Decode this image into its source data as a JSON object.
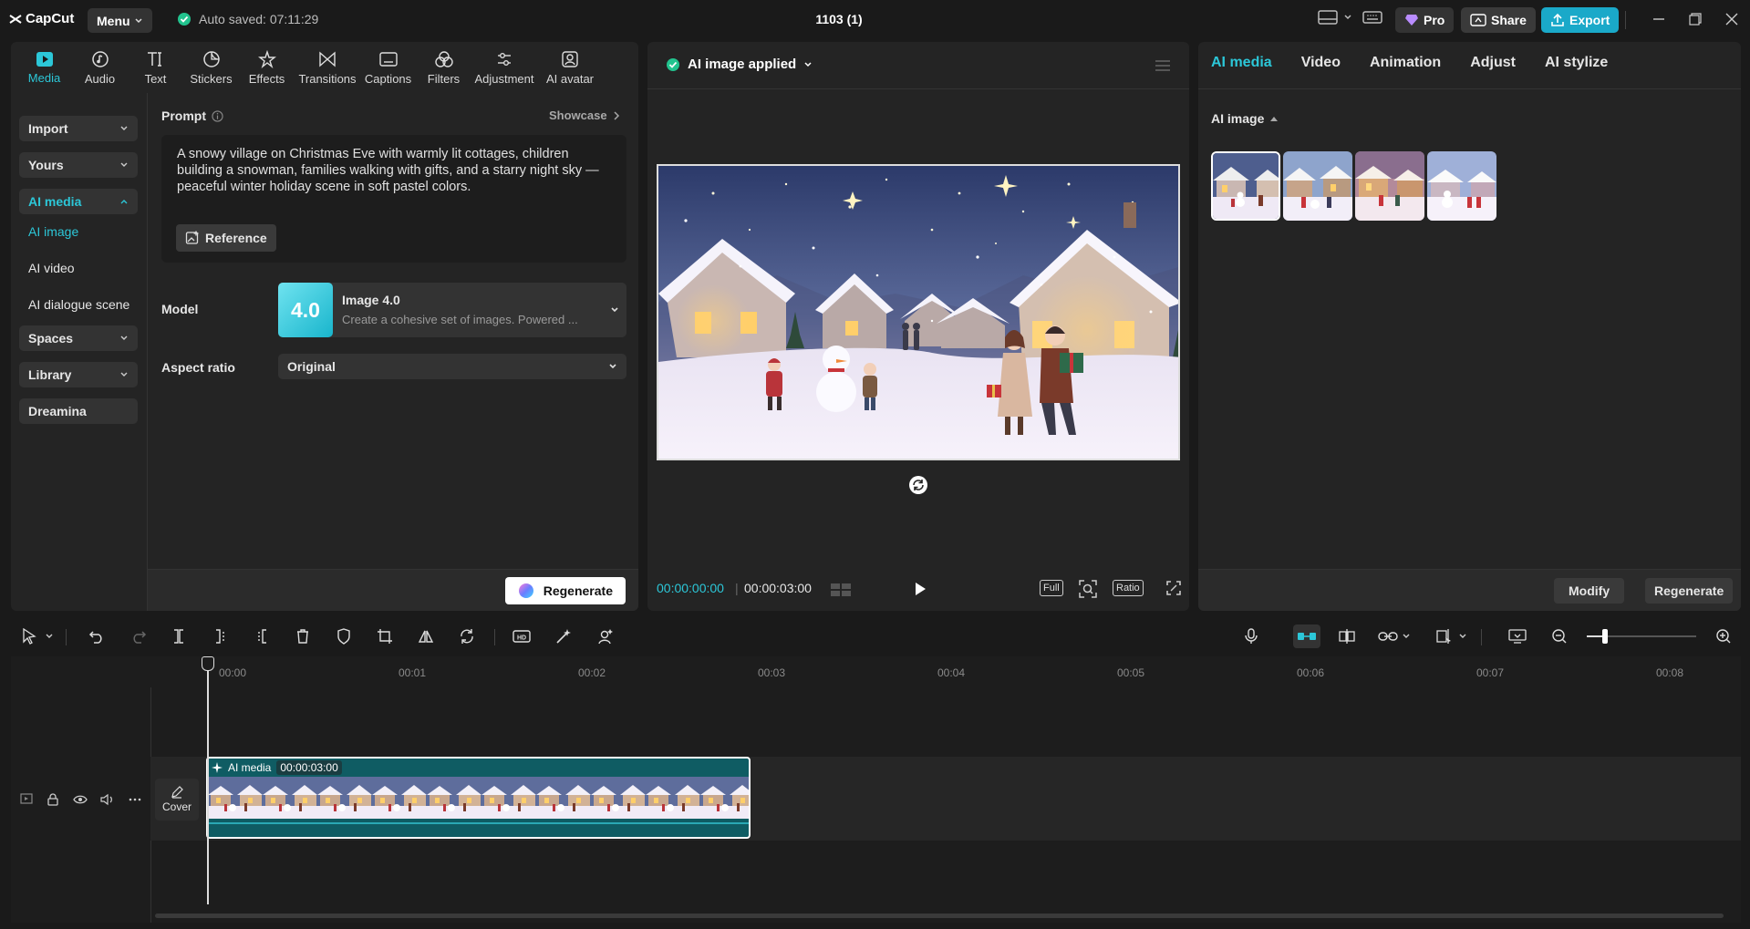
{
  "app": {
    "logo_text": "CapCut",
    "menu_label": "Menu",
    "autosave_text": "Auto saved: 07:11:29",
    "project_title": "1103 (1)",
    "pro_label": "Pro",
    "share_label": "Share",
    "export_label": "Export"
  },
  "media_tabs": [
    {
      "label": "Media",
      "icon": "media-icon",
      "active": true
    },
    {
      "label": "Audio",
      "icon": "audio-icon"
    },
    {
      "label": "Text",
      "icon": "text-icon"
    },
    {
      "label": "Stickers",
      "icon": "stickers-icon"
    },
    {
      "label": "Effects",
      "icon": "effects-icon"
    },
    {
      "label": "Transitions",
      "icon": "transitions-icon"
    },
    {
      "label": "Captions",
      "icon": "captions-icon"
    },
    {
      "label": "Filters",
      "icon": "filters-icon"
    },
    {
      "label": "Adjustment",
      "icon": "adjustment-icon"
    },
    {
      "label": "AI avatar",
      "icon": "ai-avatar-icon"
    }
  ],
  "sidebar": {
    "import": "Import",
    "yours": "Yours",
    "ai_media": "AI media",
    "ai_image": "AI image",
    "ai_video": "AI video",
    "ai_dialogue": "AI dialogue scene",
    "spaces": "Spaces",
    "library": "Library",
    "dreamina": "Dreamina"
  },
  "prompt": {
    "label": "Prompt",
    "showcase": "Showcase",
    "text": "A snowy village on Christmas Eve with warmly lit cottages, children building a snowman, families walking with gifts, and a starry night sky — peaceful winter holiday scene in soft pastel colors.",
    "reference_label": "Reference"
  },
  "model": {
    "label": "Model",
    "badge": "4.0",
    "name": "Image 4.0",
    "description": "Create a cohesive set of images. Powered ..."
  },
  "aspect": {
    "label": "Aspect ratio",
    "value": "Original"
  },
  "regenerate_label": "Regenerate",
  "preview": {
    "status": "AI image applied",
    "time_current": "00:00:00:00",
    "time_total": "00:00:03:00",
    "full_label": "Full",
    "ratio_label": "Ratio"
  },
  "right": {
    "tabs": [
      "AI media",
      "Video",
      "Animation",
      "Adjust",
      "AI stylize"
    ],
    "section": "AI image",
    "modify_label": "Modify",
    "regenerate_label": "Regenerate"
  },
  "timeline": {
    "ticks": [
      "00:00",
      "00:01",
      "00:02",
      "00:03",
      "00:04",
      "00:05",
      "00:06",
      "00:07",
      "00:08"
    ],
    "clip_label": "AI media",
    "clip_duration": "00:00:03:00",
    "cover_label": "Cover"
  },
  "colors": {
    "accent": "#2cc7d8",
    "export_bg": "#1aa9c9",
    "panel": "#242424"
  }
}
